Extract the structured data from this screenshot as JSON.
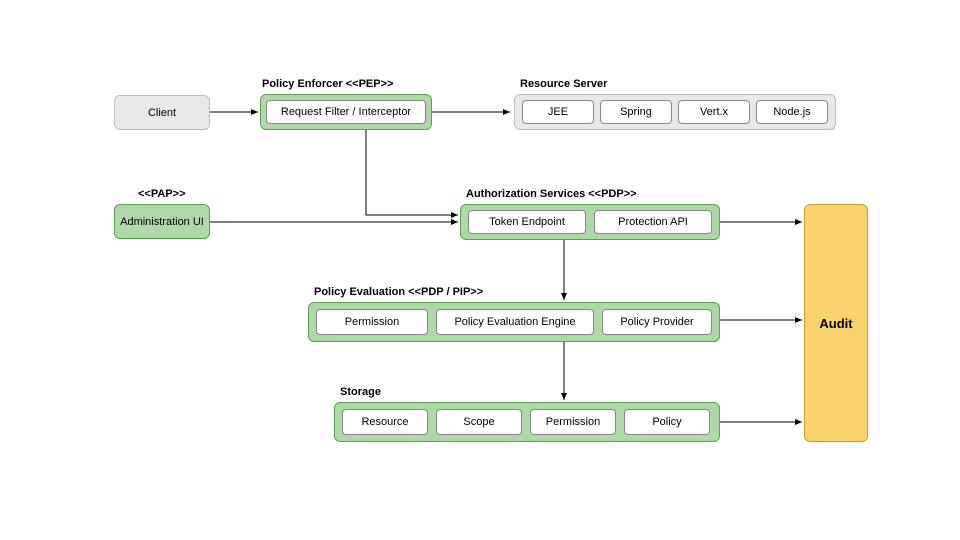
{
  "client": {
    "label": "Client"
  },
  "pep": {
    "title": "Policy Enforcer <<PEP>>",
    "items": [
      "Request Filter / Interceptor"
    ]
  },
  "resourceServer": {
    "title": "Resource Server",
    "items": [
      "JEE",
      "Spring",
      "Vert.x",
      "Node.js"
    ]
  },
  "pap": {
    "title": "<<PAP>>",
    "items": [
      "Administration UI"
    ]
  },
  "pdp": {
    "title": "Authorization Services <<PDP>>",
    "items": [
      "Token Endpoint",
      "Protection API"
    ]
  },
  "pdpPip": {
    "title": "Policy Evaluation <<PDP / PIP>>",
    "items": [
      "Permission",
      "Policy Evaluation Engine",
      "Policy Provider"
    ]
  },
  "storage": {
    "title": "Storage",
    "items": [
      "Resource",
      "Scope",
      "Permission",
      "Policy"
    ]
  },
  "audit": {
    "label": "Audit"
  }
}
